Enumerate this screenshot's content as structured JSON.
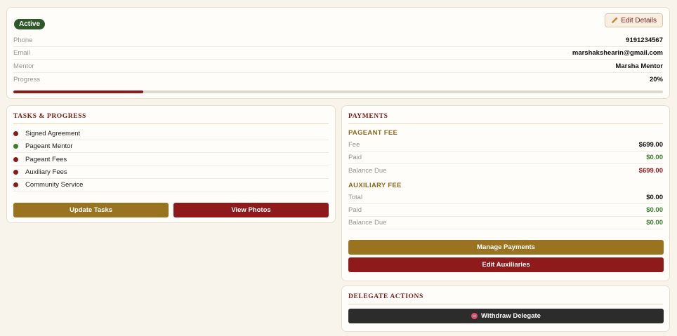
{
  "profile": {
    "status": "Active",
    "edit_label": "Edit Details",
    "fields": [
      {
        "label": "Phone",
        "value": "9191234567"
      },
      {
        "label": "Email",
        "value": "marshakshearin@gmail.com"
      },
      {
        "label": "Mentor",
        "value": "Marsha Mentor"
      },
      {
        "label": "Progress",
        "value": "20%"
      }
    ],
    "progress_fraction": 0.2,
    "progress_color": "#8b1a1a"
  },
  "tasks": {
    "title": "TASKS & PROGRESS",
    "items": [
      {
        "label": "Signed Agreement",
        "status_color": "#8b1a1a"
      },
      {
        "label": "Pageant Mentor",
        "status_color": "#3c7d30"
      },
      {
        "label": "Pageant Fees",
        "status_color": "#8b1a1a"
      },
      {
        "label": "Auxiliary Fees",
        "status_color": "#8b1a1a"
      },
      {
        "label": "Community Service",
        "status_color": "#8b1a1a"
      }
    ],
    "update_label": "Update Tasks",
    "photos_label": "View Photos"
  },
  "payments": {
    "title": "PAYMENTS",
    "pageant_fee": {
      "title": "PAGEANT FEE",
      "rows": [
        {
          "label": "Fee",
          "value": "$699.00"
        },
        {
          "label": "Paid",
          "value": "$0.00"
        },
        {
          "label": "Balance Due",
          "value": "$699.00"
        }
      ]
    },
    "auxiliary_fee": {
      "title": "AUXILIARY FEE",
      "rows": [
        {
          "label": "Total",
          "value": "$0.00"
        },
        {
          "label": "Paid",
          "value": "$0.00"
        },
        {
          "label": "Balance Due",
          "value": "$0.00"
        }
      ]
    },
    "manage_label": "Manage Payments",
    "aux_label": "Edit Auxiliaries"
  },
  "delegate": {
    "title": "DELEGATE ACTIONS",
    "withdraw_label": "Withdraw Delegate"
  },
  "colors": {
    "gold": "#9a7320",
    "maroon": "#8e1a1c",
    "green": "#3c7d30",
    "dark": "#2c2c2c"
  }
}
